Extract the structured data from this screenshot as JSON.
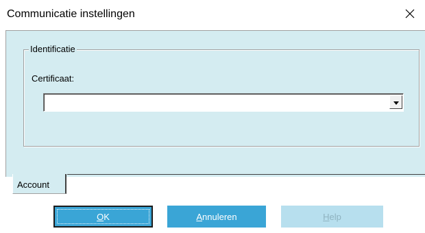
{
  "window": {
    "title": "Communicatie instellingen"
  },
  "group": {
    "legend": "Identificatie",
    "certificate_label": "Certificaat:",
    "certificate_value": ""
  },
  "tabs": [
    {
      "label": "Account",
      "active": true
    }
  ],
  "buttons": {
    "ok": {
      "mnemonic": "O",
      "rest": "K"
    },
    "cancel": {
      "mnemonic": "A",
      "rest": "nnuleren"
    },
    "help": {
      "mnemonic": "H",
      "rest": "elp",
      "disabled": true
    }
  },
  "colors": {
    "panel": "#d4ecf1",
    "button": "#3aa5d6",
    "button_disabled": "#b7dfee"
  },
  "icons": {
    "close": "close-icon",
    "dropdown": "chevron-down-icon"
  }
}
